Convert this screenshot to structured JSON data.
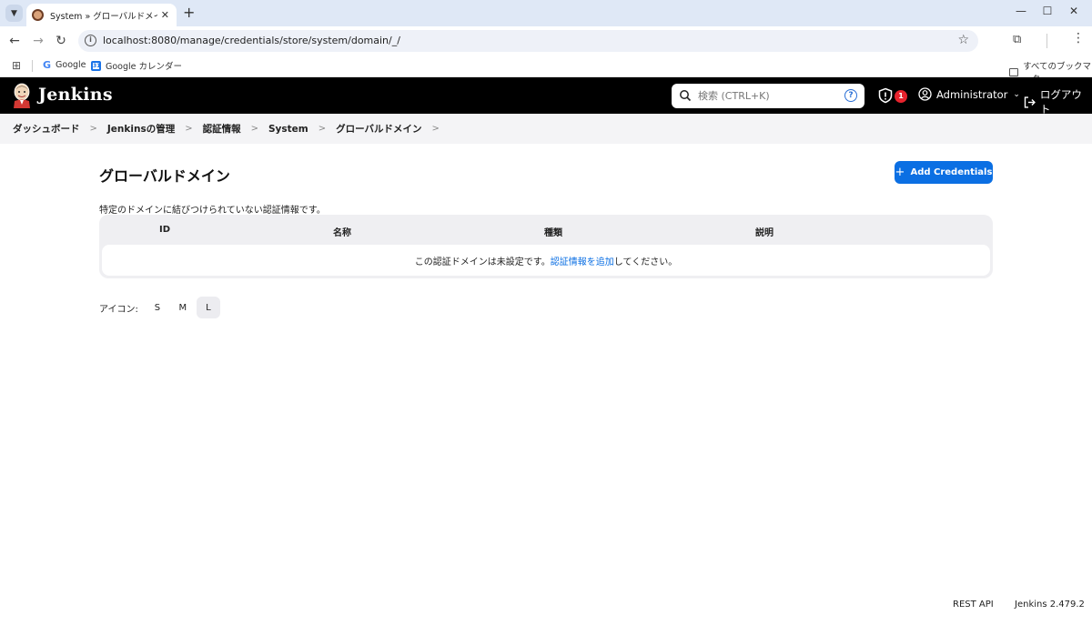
{
  "browser": {
    "tab_title": "System » グローバルドメイン [Jenkins]",
    "url": "localhost:8080/manage/credentials/store/system/domain/_/",
    "bookmarks": [
      "Google",
      "Google カレンダー"
    ],
    "all_bookmarks": "すべてのブックマーク"
  },
  "header": {
    "logo_text": "Jenkins",
    "search_placeholder": "検索 (CTRL+K)",
    "help_glyph": "?",
    "alert_count": "1",
    "user_name": "Administrator",
    "logout_label": "ログアウト"
  },
  "breadcrumb": [
    "ダッシュボード",
    "Jenkinsの管理",
    "認証情報",
    "System",
    "グローバルドメイン"
  ],
  "main": {
    "title": "グローバルドメイン",
    "add_button_label": "Add Credentials",
    "description": "特定のドメインに結びつけられていない認証情報です。",
    "table": {
      "columns": [
        "ID",
        "名称",
        "種類",
        "説明"
      ],
      "empty_prefix": "この認証ドメインは未設定です。",
      "empty_link": "認証情報を追加",
      "empty_suffix": "してください。"
    },
    "icon_size": {
      "label": "アイコン:",
      "options": [
        "S",
        "M",
        "L"
      ],
      "selected": "L"
    }
  },
  "footer": {
    "rest_api": "REST API",
    "version": "Jenkins 2.479.2"
  },
  "colors": {
    "header_bg": "#000000",
    "primary": "#0b6fe3",
    "alert": "#e7232d"
  }
}
